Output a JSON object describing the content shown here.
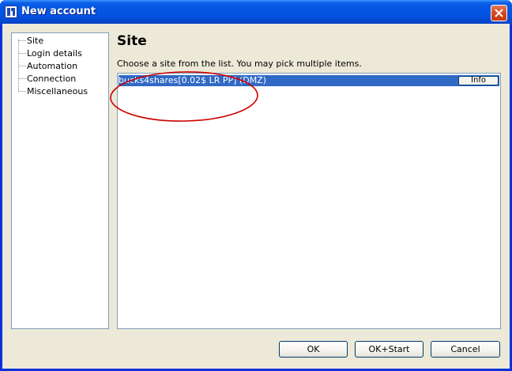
{
  "window": {
    "title": "New account"
  },
  "tree": {
    "items": [
      {
        "label": "Site"
      },
      {
        "label": "Login details"
      },
      {
        "label": "Automation"
      },
      {
        "label": "Connection"
      },
      {
        "label": "Miscellaneous"
      }
    ]
  },
  "main": {
    "heading": "Site",
    "hint": "Choose a site from the list. You may pick multiple items.",
    "sites": [
      {
        "name": "bucks4shares[0.02$ LR PP] (DMZ)",
        "info_label": "Info",
        "selected": true
      }
    ]
  },
  "footer": {
    "ok_label": "OK",
    "ok_start_label": "OK+Start",
    "cancel_label": "Cancel"
  },
  "colors": {
    "titlebar": "#0554e3",
    "selection": "#316ac5",
    "dialog_bg": "#ece9d8",
    "annotation": "#cc0000",
    "close_button": "#d6471c"
  }
}
